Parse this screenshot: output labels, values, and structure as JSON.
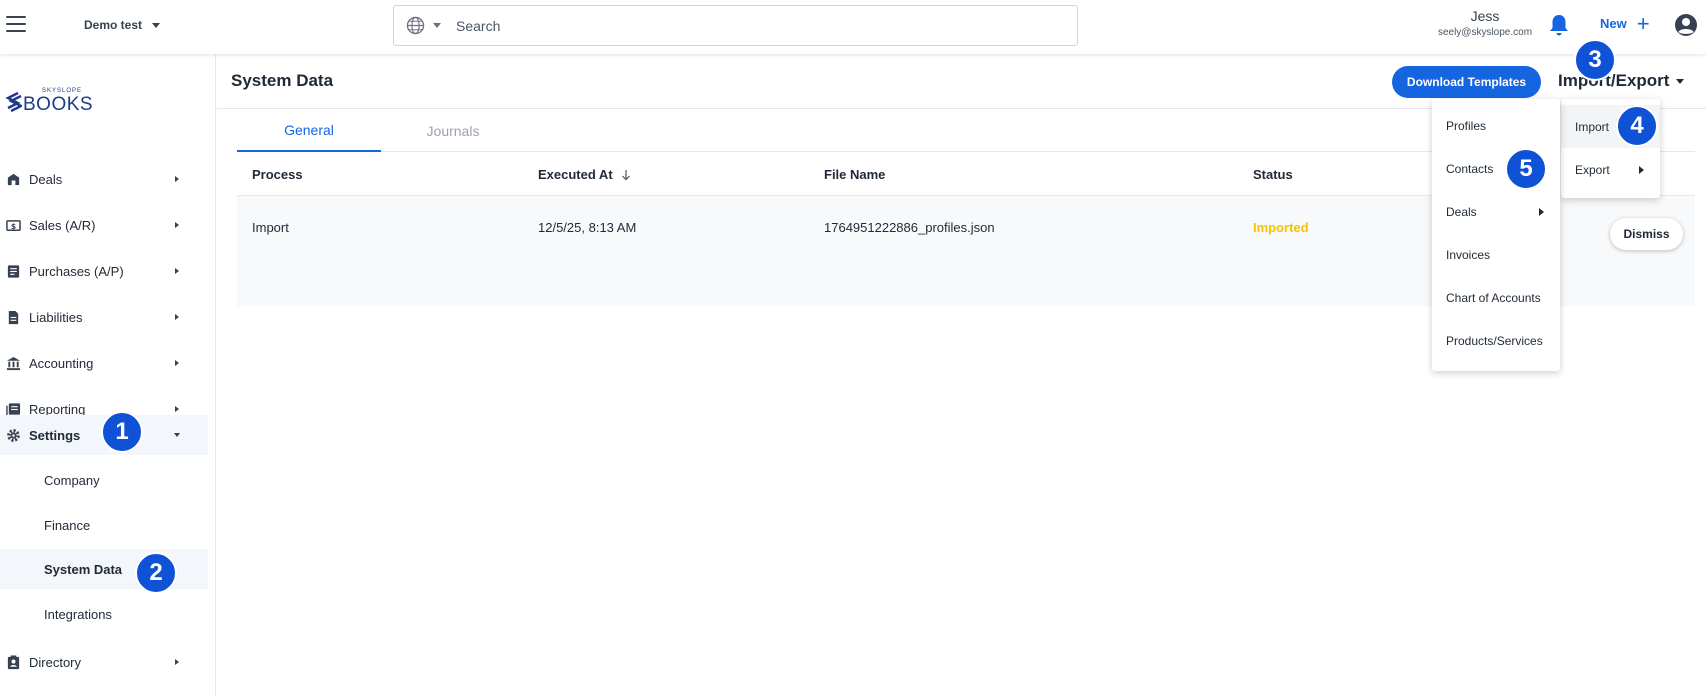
{
  "topbar": {
    "workspace": "Demo test",
    "search_placeholder": "Search",
    "user_name": "Jess",
    "user_email": "seely@skyslope.com",
    "new_label": "New",
    "new_plus": "+"
  },
  "logo": {
    "small_text": "SKYSLOPE",
    "brand": "BOOKS",
    "brand_color": "#1e3a8a"
  },
  "sidebar": {
    "items": [
      {
        "label": "Deals",
        "icon": "store-icon"
      },
      {
        "label": "Sales (A/R)",
        "icon": "dollar-bill-icon"
      },
      {
        "label": "Purchases (A/P)",
        "icon": "receipt-icon"
      },
      {
        "label": "Liabilities",
        "icon": "document-icon"
      },
      {
        "label": "Accounting",
        "icon": "bank-icon"
      },
      {
        "label": "Reporting",
        "icon": "report-icon"
      },
      {
        "label": "Settings",
        "icon": "gear-icon"
      }
    ],
    "settings_sub": [
      "Company",
      "Finance",
      "System Data",
      "Integrations"
    ],
    "directory": {
      "label": "Directory",
      "icon": "contacts-icon"
    }
  },
  "page": {
    "title": "System Data",
    "download_templates": "Download Templates",
    "import_export": "Import/Export",
    "accent": "#1565e0"
  },
  "tabs": [
    "General",
    "Journals"
  ],
  "table": {
    "headers": [
      "Process",
      "Executed At",
      "File Name",
      "Status"
    ],
    "rows": [
      {
        "process": "Import",
        "executed_at": "12/5/25, 8:13 AM",
        "file_name": "1764951222886_profiles.json",
        "status": "Imported",
        "action": "Dismiss"
      }
    ],
    "status_color": "#f5c400"
  },
  "import_export_menu": [
    "Import",
    "Export"
  ],
  "import_submenu": [
    "Profiles",
    "Contacts",
    "Deals",
    "Invoices",
    "Chart of Accounts",
    "Products/Services"
  ],
  "badges": [
    "1",
    "2",
    "3",
    "4",
    "5"
  ],
  "badge_color": "#1052d6"
}
